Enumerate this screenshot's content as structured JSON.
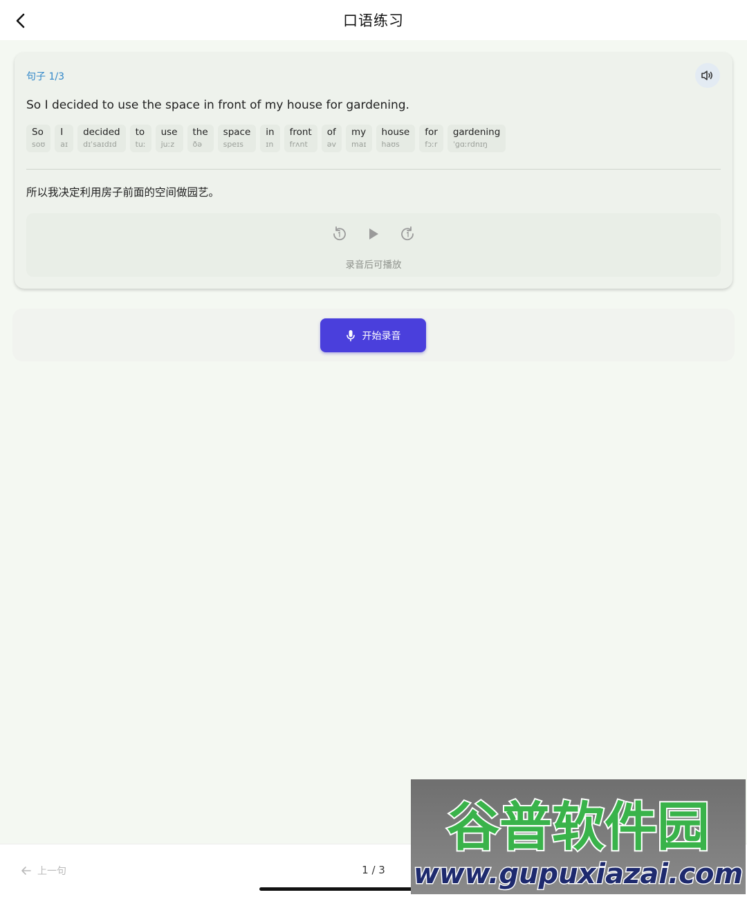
{
  "header": {
    "title": "口语练习"
  },
  "card": {
    "sentence_index": "句子 1/3",
    "sentence_en": "So I decided to use the space in front of my house for gardening.",
    "words": [
      {
        "word": "So",
        "phonetic": "soʊ"
      },
      {
        "word": "I",
        "phonetic": "aɪ"
      },
      {
        "word": "decided",
        "phonetic": "dɪˈsaɪdɪd"
      },
      {
        "word": "to",
        "phonetic": "tuː"
      },
      {
        "word": "use",
        "phonetic": "juːz"
      },
      {
        "word": "the",
        "phonetic": "ðə"
      },
      {
        "word": "space",
        "phonetic": "speɪs"
      },
      {
        "word": "in",
        "phonetic": "ɪn"
      },
      {
        "word": "front",
        "phonetic": "frʌnt"
      },
      {
        "word": "of",
        "phonetic": "əv"
      },
      {
        "word": "my",
        "phonetic": "maɪ"
      },
      {
        "word": "house",
        "phonetic": "haʊs"
      },
      {
        "word": "for",
        "phonetic": "fɔːr"
      },
      {
        "word": "gardening",
        "phonetic": "ˈɡɑːrdnɪŋ"
      }
    ],
    "sentence_zh": "所以我决定利用房子前面的空间做园艺。",
    "player_hint": "录音后可播放"
  },
  "record": {
    "label": "开始录音"
  },
  "footer": {
    "prev_label": "上一句",
    "page": "1 / 3"
  },
  "watermark": {
    "brand": "谷普软件园",
    "url": "www.gupuxiazai.com"
  },
  "colors": {
    "accent": "#4a3fdc",
    "index_blue": "#2f86c9",
    "background": "#f4f8f2"
  }
}
